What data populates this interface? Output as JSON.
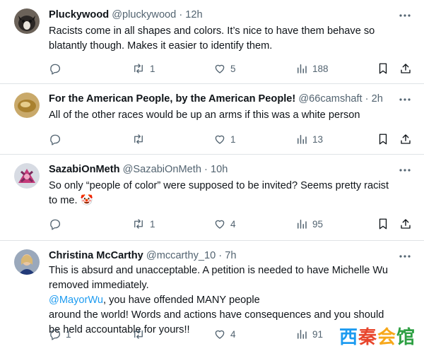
{
  "tweets": [
    {
      "name": "Pluckywood",
      "handle": "@pluckywood",
      "sep": "·",
      "time": "12h",
      "lines": [
        "Racists come in all shapes and colors. It’s nice to have them behave so",
        "blatantly though. Makes it easier to identify them."
      ],
      "replies": "",
      "retweets": "1",
      "likes": "5",
      "views": "188"
    },
    {
      "name": "For the American People, by the American People!",
      "handle": "@66camshaft",
      "sep": "·",
      "time": "2h",
      "lines": [
        "All of the other races would be up an arms if this was a white person"
      ],
      "replies": "",
      "retweets": "",
      "likes": "1",
      "views": "13"
    },
    {
      "name": "SazabiOnMeth",
      "handle": "@SazabiOnMeth",
      "sep": "·",
      "time": "10h",
      "lines": [
        "So only “people of color” were supposed to be invited? Seems pretty racist",
        "to me."
      ],
      "emoji": "🤡",
      "replies": "",
      "retweets": "1",
      "likes": "4",
      "views": "95"
    },
    {
      "name": "Christina McCarthy",
      "handle": "@mccarthy_10",
      "sep": "·",
      "time": "7h",
      "lines": [
        "This is absurd and unacceptable.  A petition is needed to have Michelle Wu",
        "removed immediately."
      ],
      "mention": "@MayorWu",
      "line2b": ", you have offended MANY people",
      "lines_after": [
        "around the world! Words and actions have consequences and you should",
        "be held accountable for yours!!"
      ],
      "replies": "1",
      "retweets": "",
      "likes": "4",
      "views": "91"
    }
  ],
  "watermark": {
    "text": "西秦会馆",
    "colors": [
      "#1d9bf0",
      "#e8452c",
      "#f7a81b",
      "#2ea043"
    ]
  },
  "colors": {
    "text": "#0f1419",
    "muted": "#536471",
    "link": "#1d9bf0",
    "divider": "#dfe3e6"
  },
  "icons": [
    "more-icon",
    "reply-icon",
    "retweet-icon",
    "like-icon",
    "views-icon",
    "bookmark-icon",
    "share-icon"
  ]
}
